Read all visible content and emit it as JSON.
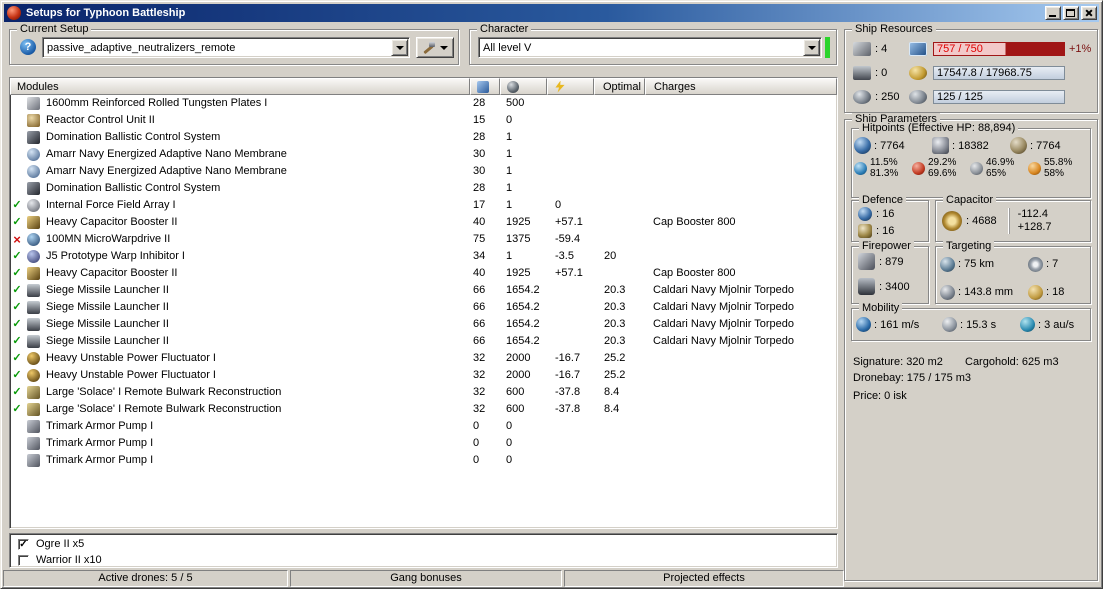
{
  "window": {
    "title": "Setups for Typhoon Battleship"
  },
  "current_setup": {
    "label": "Current Setup",
    "help_glyph": "?",
    "selected": "passive_adaptive_neutralizers_remote"
  },
  "character": {
    "label": "Character",
    "selected": "All level V",
    "indicator_color": "#2cd42c"
  },
  "modules": {
    "title": "Modules",
    "columns": {
      "cpu_icon": "cpu-column-icon",
      "powergrid_icon": "powergrid-column-icon",
      "capacitor_icon": "capacitor-column-icon",
      "optimal": "Optimal",
      "charges": "Charges"
    },
    "rows": [
      {
        "status": "",
        "icon": "armor-plate-icon",
        "name": "1600mm Reinforced Rolled Tungsten Plates I",
        "cpu": "28",
        "pg": "500",
        "cap": "",
        "optimal": "",
        "charges": ""
      },
      {
        "status": "",
        "icon": "reactor-control-icon",
        "name": "Reactor Control Unit II",
        "cpu": "15",
        "pg": "0",
        "cap": "",
        "optimal": "",
        "charges": ""
      },
      {
        "status": "",
        "icon": "ballistic-control-icon",
        "name": "Domination Ballistic Control System",
        "cpu": "28",
        "pg": "1",
        "cap": "",
        "optimal": "",
        "charges": ""
      },
      {
        "status": "",
        "icon": "nano-membrane-icon",
        "name": "Amarr Navy Energized Adaptive Nano Membrane",
        "cpu": "30",
        "pg": "1",
        "cap": "",
        "optimal": "",
        "charges": ""
      },
      {
        "status": "",
        "icon": "nano-membrane-icon",
        "name": "Amarr Navy Energized Adaptive Nano Membrane",
        "cpu": "30",
        "pg": "1",
        "cap": "",
        "optimal": "",
        "charges": ""
      },
      {
        "status": "",
        "icon": "ballistic-control-icon",
        "name": "Domination Ballistic Control System",
        "cpu": "28",
        "pg": "1",
        "cap": "",
        "optimal": "",
        "charges": ""
      },
      {
        "status": "ok",
        "icon": "force-field-array-icon",
        "name": "Internal Force Field Array I",
        "cpu": "17",
        "pg": "1",
        "cap": "0",
        "optimal": "",
        "charges": ""
      },
      {
        "status": "ok",
        "icon": "cap-booster-icon",
        "name": "Heavy Capacitor Booster II",
        "cpu": "40",
        "pg": "1925",
        "cap": "+57.1",
        "optimal": "",
        "charges": "Cap Booster 800"
      },
      {
        "status": "off",
        "icon": "microwarpdrive-icon",
        "name": "100MN MicroWarpdrive II",
        "cpu": "75",
        "pg": "1375",
        "cap": "-59.4",
        "optimal": "",
        "charges": ""
      },
      {
        "status": "ok",
        "icon": "warp-inhibitor-icon",
        "name": "J5 Prototype Warp Inhibitor I",
        "cpu": "34",
        "pg": "1",
        "cap": "-3.5",
        "optimal": "20",
        "charges": ""
      },
      {
        "status": "ok",
        "icon": "cap-booster-icon",
        "name": "Heavy Capacitor Booster II",
        "cpu": "40",
        "pg": "1925",
        "cap": "+57.1",
        "optimal": "",
        "charges": "Cap Booster 800"
      },
      {
        "status": "ok",
        "icon": "missile-launcher-icon",
        "name": "Siege Missile Launcher II",
        "cpu": "66",
        "pg": "1654.2",
        "cap": "",
        "optimal": "20.3",
        "charges": "Caldari Navy Mjolnir Torpedo"
      },
      {
        "status": "ok",
        "icon": "missile-launcher-icon",
        "name": "Siege Missile Launcher II",
        "cpu": "66",
        "pg": "1654.2",
        "cap": "",
        "optimal": "20.3",
        "charges": "Caldari Navy Mjolnir Torpedo"
      },
      {
        "status": "ok",
        "icon": "missile-launcher-icon",
        "name": "Siege Missile Launcher II",
        "cpu": "66",
        "pg": "1654.2",
        "cap": "",
        "optimal": "20.3",
        "charges": "Caldari Navy Mjolnir Torpedo"
      },
      {
        "status": "ok",
        "icon": "missile-launcher-icon",
        "name": "Siege Missile Launcher II",
        "cpu": "66",
        "pg": "1654.2",
        "cap": "",
        "optimal": "20.3",
        "charges": "Caldari Navy Mjolnir Torpedo"
      },
      {
        "status": "ok",
        "icon": "power-fluctuator-icon",
        "name": "Heavy Unstable Power Fluctuator I",
        "cpu": "32",
        "pg": "2000",
        "cap": "-16.7",
        "optimal": "25.2",
        "charges": ""
      },
      {
        "status": "ok",
        "icon": "power-fluctuator-icon",
        "name": "Heavy Unstable Power Fluctuator I",
        "cpu": "32",
        "pg": "2000",
        "cap": "-16.7",
        "optimal": "25.2",
        "charges": ""
      },
      {
        "status": "ok",
        "icon": "remote-repair-icon",
        "name": "Large 'Solace' I Remote Bulwark Reconstruction",
        "cpu": "32",
        "pg": "600",
        "cap": "-37.8",
        "optimal": "8.4",
        "charges": ""
      },
      {
        "status": "ok",
        "icon": "remote-repair-icon",
        "name": "Large 'Solace' I Remote Bulwark Reconstruction",
        "cpu": "32",
        "pg": "600",
        "cap": "-37.8",
        "optimal": "8.4",
        "charges": ""
      },
      {
        "status": "",
        "icon": "armor-rig-icon",
        "name": "Trimark Armor Pump I",
        "cpu": "0",
        "pg": "0",
        "cap": "",
        "optimal": "",
        "charges": ""
      },
      {
        "status": "",
        "icon": "armor-rig-icon",
        "name": "Trimark Armor Pump I",
        "cpu": "0",
        "pg": "0",
        "cap": "",
        "optimal": "",
        "charges": ""
      },
      {
        "status": "",
        "icon": "armor-rig-icon",
        "name": "Trimark Armor Pump I",
        "cpu": "0",
        "pg": "0",
        "cap": "",
        "optimal": "",
        "charges": ""
      }
    ]
  },
  "drones": {
    "items": [
      {
        "checked": true,
        "label": "Ogre II x5"
      },
      {
        "checked": false,
        "label": "Warrior II x10"
      }
    ]
  },
  "statusbar": {
    "active_drones": "Active drones: 5 / 5",
    "gang_bonuses": "Gang bonuses",
    "projected_effects": "Projected effects"
  },
  "ship_resources": {
    "label": "Ship Resources",
    "slots": [
      {
        "icon": "turret-hardpoint-icon",
        "value": ": 4"
      },
      {
        "icon": "launcher-hardpoint-icon",
        "value": ": 0"
      },
      {
        "icon": "calibration-icon",
        "value": ": 250"
      }
    ],
    "bars": [
      {
        "icon": "cpu-icon",
        "text": "757 / 750",
        "extra": "+1%",
        "over_color": "#e00000"
      },
      {
        "icon": "powergrid-icon",
        "text": "17547.8 / 17968.75",
        "extra": ""
      },
      {
        "icon": "drone-bandwidth-icon",
        "text": "125 / 125",
        "extra": ""
      }
    ]
  },
  "ship_parameters": {
    "label": "Ship Parameters",
    "hitpoints": {
      "label": "Hitpoints (Effective HP: 88,894)",
      "values": [
        {
          "icon": "shield-icon",
          "value": ": 7764"
        },
        {
          "icon": "armor-icon",
          "value": ": 18382"
        },
        {
          "icon": "hull-icon",
          "value": ": 7764"
        }
      ],
      "resists": [
        {
          "icon": "em-resist-icon",
          "top": "11.5%",
          "bottom": "81.3%"
        },
        {
          "icon": "thermal-resist-icon",
          "top": "29.2%",
          "bottom": "69.6%"
        },
        {
          "icon": "kinetic-resist-icon",
          "top": "46.9%",
          "bottom": "65%"
        },
        {
          "icon": "explosive-resist-icon",
          "top": "55.8%",
          "bottom": "58%"
        }
      ]
    },
    "defence": {
      "label": "Defence",
      "rows": [
        {
          "icon": "shield-recharge-icon",
          "value": ": 16"
        },
        {
          "icon": "armor-repair-icon",
          "value": ": 16"
        }
      ]
    },
    "capacitor": {
      "label": "Capacitor",
      "icon": "capacitor-icon",
      "value": ": 4688",
      "drain": "-112.4",
      "recharge": "+128.7"
    },
    "firepower": {
      "label": "Firepower",
      "rows": [
        {
          "icon": "turret-dps-icon",
          "value": ": 879"
        },
        {
          "icon": "missile-volley-icon",
          "value": ": 3400"
        }
      ]
    },
    "targeting": {
      "label": "Targeting",
      "cells": [
        {
          "icon": "target-range-icon",
          "value": ": 75 km"
        },
        {
          "icon": "max-targets-icon",
          "value": ": 7"
        },
        {
          "icon": "scan-resolution-icon",
          "value": ": 143.8 mm"
        },
        {
          "icon": "sensor-strength-icon",
          "value": ": 18"
        }
      ]
    },
    "mobility": {
      "label": "Mobility",
      "cells": [
        {
          "icon": "speed-icon",
          "value": ": 161 m/s"
        },
        {
          "icon": "align-time-icon",
          "value": ": 15.3 s"
        },
        {
          "icon": "warp-speed-icon",
          "value": ": 3 au/s"
        }
      ]
    },
    "signature": "Signature: 320 m2",
    "cargohold": "Cargohold: 625 m3",
    "dronebay": "Dronebay: 175 / 175 m3",
    "price": "Price: 0 isk"
  }
}
